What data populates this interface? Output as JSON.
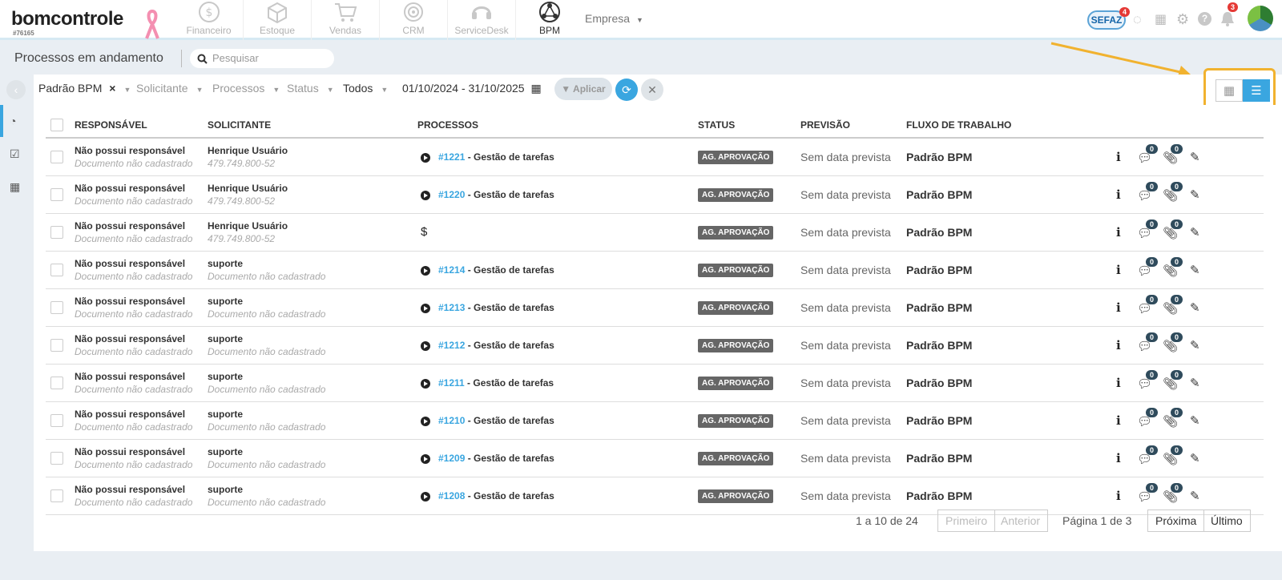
{
  "app": {
    "logo": "bomcontrole",
    "account_id": "#76165",
    "modules": [
      {
        "label": "Financeiro",
        "icon": "dollar-circle-icon",
        "active": false
      },
      {
        "label": "Estoque",
        "icon": "box-icon",
        "active": false
      },
      {
        "label": "Vendas",
        "icon": "cart-icon",
        "active": false
      },
      {
        "label": "CRM",
        "icon": "target-icon",
        "active": false
      },
      {
        "label": "ServiceDesk",
        "icon": "headset-icon",
        "active": false
      },
      {
        "label": "BPM",
        "icon": "bpm-network-icon",
        "active": true
      }
    ],
    "company_menu": "Empresa",
    "sefaz_label": "SEFAZ",
    "sefaz_badge": "4",
    "notifications_badge": "3",
    "accent_color": "#3aa6e0",
    "highlight_color": "#f1b22f"
  },
  "page": {
    "title": "Processos em andamento",
    "search_placeholder": "Pesquisar"
  },
  "filters": {
    "workflow": "Padrão BPM",
    "workflow_clear": "×",
    "requester": "Solicitante",
    "processes": "Processos",
    "status": "Status",
    "all": "Todos",
    "date_range": "01/10/2024 - 31/10/2025",
    "apply": "Aplicar"
  },
  "table": {
    "headers": {
      "responsible": "RESPONSÁVEL",
      "requester": "SOLICITANTE",
      "processes": "PROCESSOS",
      "status": "STATUS",
      "forecast": "PREVISÃO",
      "workflow": "FLUXO DE TRABALHO"
    },
    "rows": [
      {
        "resp": "Não possui responsável",
        "resp_doc": "Documento não cadastrado",
        "req": "Henrique Usuário",
        "req_doc": "479.749.800-52",
        "proc_id": "#1221",
        "proc_name": " - Gestão de tarefas",
        "proc_icon": "play-icon",
        "status": "AG. APROVAÇÃO",
        "forecast": "Sem data prevista",
        "flow": "Padrão BPM",
        "comments": "0",
        "attachments": "0"
      },
      {
        "resp": "Não possui responsável",
        "resp_doc": "Documento não cadastrado",
        "req": "Henrique Usuário",
        "req_doc": "479.749.800-52",
        "proc_id": "#1220",
        "proc_name": " - Gestão de tarefas",
        "proc_icon": "play-icon",
        "status": "AG. APROVAÇÃO",
        "forecast": "Sem data prevista",
        "flow": "Padrão BPM",
        "comments": "0",
        "attachments": "0"
      },
      {
        "resp": "Não possui responsável",
        "resp_doc": "Documento não cadastrado",
        "req": "Henrique Usuário",
        "req_doc": "479.749.800-52",
        "proc_id": "",
        "proc_name": "",
        "proc_icon": "dollar-icon",
        "status": "AG. APROVAÇÃO",
        "forecast": "Sem data prevista",
        "flow": "Padrão BPM",
        "comments": "0",
        "attachments": "0"
      },
      {
        "resp": "Não possui responsável",
        "resp_doc": "Documento não cadastrado",
        "req": "suporte",
        "req_doc": "Documento não cadastrado",
        "proc_id": "#1214",
        "proc_name": " - Gestão de tarefas",
        "proc_icon": "play-icon",
        "status": "AG. APROVAÇÃO",
        "forecast": "Sem data prevista",
        "flow": "Padrão BPM",
        "comments": "0",
        "attachments": "0"
      },
      {
        "resp": "Não possui responsável",
        "resp_doc": "Documento não cadastrado",
        "req": "suporte",
        "req_doc": "Documento não cadastrado",
        "proc_id": "#1213",
        "proc_name": " - Gestão de tarefas",
        "proc_icon": "play-icon",
        "status": "AG. APROVAÇÃO",
        "forecast": "Sem data prevista",
        "flow": "Padrão BPM",
        "comments": "0",
        "attachments": "0"
      },
      {
        "resp": "Não possui responsável",
        "resp_doc": "Documento não cadastrado",
        "req": "suporte",
        "req_doc": "Documento não cadastrado",
        "proc_id": "#1212",
        "proc_name": " - Gestão de tarefas",
        "proc_icon": "play-icon",
        "status": "AG. APROVAÇÃO",
        "forecast": "Sem data prevista",
        "flow": "Padrão BPM",
        "comments": "0",
        "attachments": "0"
      },
      {
        "resp": "Não possui responsável",
        "resp_doc": "Documento não cadastrado",
        "req": "suporte",
        "req_doc": "Documento não cadastrado",
        "proc_id": "#1211",
        "proc_name": " - Gestão de tarefas",
        "proc_icon": "play-icon",
        "status": "AG. APROVAÇÃO",
        "forecast": "Sem data prevista",
        "flow": "Padrão BPM",
        "comments": "0",
        "attachments": "0"
      },
      {
        "resp": "Não possui responsável",
        "resp_doc": "Documento não cadastrado",
        "req": "suporte",
        "req_doc": "Documento não cadastrado",
        "proc_id": "#1210",
        "proc_name": " - Gestão de tarefas",
        "proc_icon": "play-icon",
        "status": "AG. APROVAÇÃO",
        "forecast": "Sem data prevista",
        "flow": "Padrão BPM",
        "comments": "0",
        "attachments": "0"
      },
      {
        "resp": "Não possui responsável",
        "resp_doc": "Documento não cadastrado",
        "req": "suporte",
        "req_doc": "Documento não cadastrado",
        "proc_id": "#1209",
        "proc_name": " - Gestão de tarefas",
        "proc_icon": "play-icon",
        "status": "AG. APROVAÇÃO",
        "forecast": "Sem data prevista",
        "flow": "Padrão BPM",
        "comments": "0",
        "attachments": "0"
      },
      {
        "resp": "Não possui responsável",
        "resp_doc": "Documento não cadastrado",
        "req": "suporte",
        "req_doc": "Documento não cadastrado",
        "proc_id": "#1208",
        "proc_name": " - Gestão de tarefas",
        "proc_icon": "play-icon",
        "status": "AG. APROVAÇÃO",
        "forecast": "Sem data prevista",
        "flow": "Padrão BPM",
        "comments": "0",
        "attachments": "0"
      }
    ]
  },
  "pagination": {
    "range": "1 a 10 de 24",
    "first": "Primeiro",
    "previous": "Anterior",
    "page": "Página 1 de 3",
    "next": "Próxima",
    "last": "Último"
  }
}
